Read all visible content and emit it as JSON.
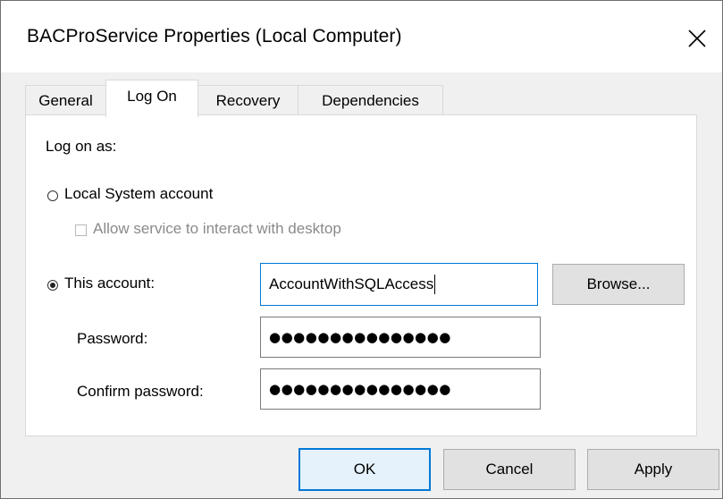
{
  "window": {
    "title": "BACProService Properties (Local Computer)"
  },
  "tabs": [
    {
      "label": "General"
    },
    {
      "label": "Log On"
    },
    {
      "label": "Recovery"
    },
    {
      "label": "Dependencies"
    }
  ],
  "logon": {
    "log_on_as_label": "Log on as:",
    "local_system_label": "Local System account",
    "local_system_selected": false,
    "allow_interact_label": "Allow service to interact with desktop",
    "allow_interact_checked": false,
    "this_account_label": "This account:",
    "this_account_selected": true,
    "account_value": "AccountWithSQLAccess",
    "browse_label": "Browse...",
    "password_label": "Password:",
    "password_value": "●●●●●●●●●●●●●●●",
    "confirm_password_label": "Confirm password:",
    "confirm_password_value": "●●●●●●●●●●●●●●●"
  },
  "footer": {
    "ok_label": "OK",
    "cancel_label": "Cancel",
    "apply_label": "Apply"
  },
  "colors": {
    "accent": "#0078d7",
    "dialog_bg": "#f0f0f0",
    "panel_bg": "#ffffff"
  },
  "icons": {
    "close": "close-icon"
  }
}
